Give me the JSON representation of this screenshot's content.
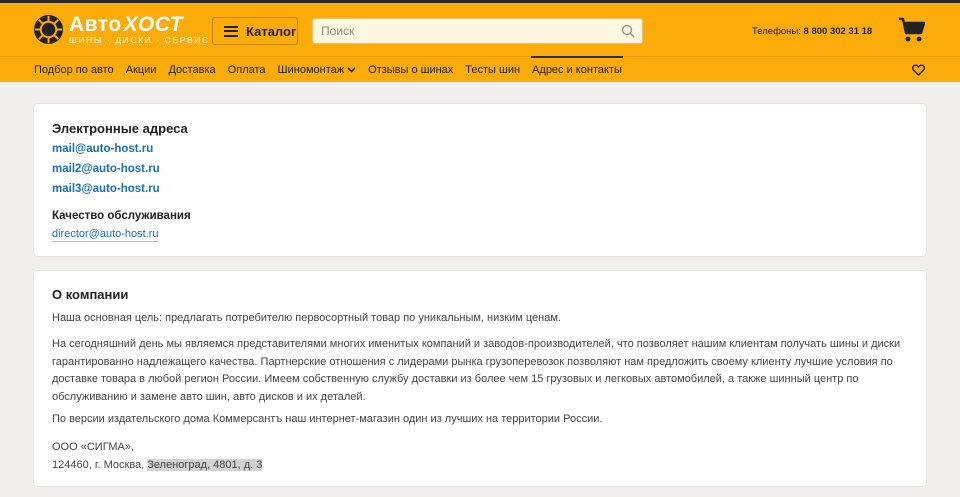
{
  "header": {
    "logo": {
      "word1": "Авто",
      "word2": "ХОСТ",
      "tagline": "ШИНЫ · ДИСКИ · СЕРВИС"
    },
    "catalog_label": "Каталог",
    "search": {
      "placeholder": "Поиск",
      "value": ""
    },
    "phone_label": "Телефоны:",
    "phone_number": "8 800 302 31 18",
    "colors": {
      "brand": "#fbac0a",
      "link": "#1c6fb8"
    }
  },
  "nav": {
    "items": [
      {
        "label": "Подбор по авто"
      },
      {
        "label": "Акции"
      },
      {
        "label": "Доставка"
      },
      {
        "label": "Оплата"
      },
      {
        "label": "Шиномонтаж"
      },
      {
        "label": "Отзывы о шинах"
      },
      {
        "label": "Тесты шин"
      },
      {
        "label": "Адрес и контакты"
      }
    ]
  },
  "emails": {
    "title": "Электронные адреса",
    "list": [
      "mail@auto-host.ru",
      "mail2@auto-host.ru",
      "mail3@auto-host.ru"
    ],
    "quality_title": "Качество обслуживания",
    "quality_email": "director@auto-host.ru"
  },
  "about": {
    "title": "О компании",
    "p1": "Наша основная цель: предлагать потребителю первосортный товар по уникальным, низким ценам.",
    "p2": "На сегодняшний день мы являемся представителями многих именитых компаний и заводов-производителей, что позволяет нашим клиентам получать шины и диски гарантированно надлежащего качества. Партнерские отношения с лидерами рынка грузоперевозок позволяют нам предложить своему клиенту лучшие условия по доставке товара в любой регион России. Имеем собственную службу доставки из более чем 15 грузовых и легковых автомобилей, а также шинный центр по обслуживанию и замене авто шин, авто дисков и их деталей.",
    "p3": "По версии издательского дома Коммерсантъ наш интернет-магазин один из лучших на территории России.",
    "company": "ООО «СИГМА»,",
    "address_start": "124460, г. Москва, ",
    "address_highlight": "Зеленоград, 4801, д. 3"
  }
}
